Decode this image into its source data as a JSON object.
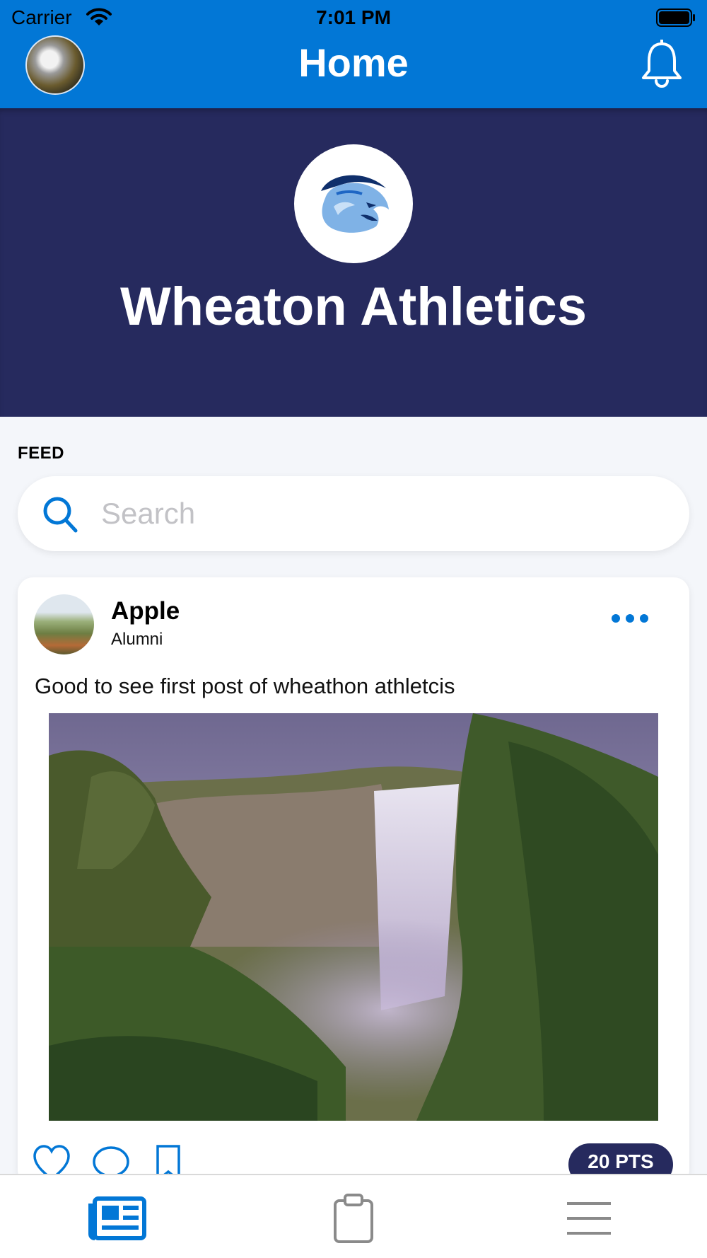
{
  "status_bar": {
    "carrier": "Carrier",
    "time": "7:01 PM",
    "wifi_icon": "wifi-icon",
    "battery_icon": "battery-icon"
  },
  "nav": {
    "title": "Home",
    "avatar_icon": "profile-avatar",
    "notification_icon": "bell-icon"
  },
  "hero": {
    "title": "Wheaton Athletics",
    "logo_icon": "wildcat-logo"
  },
  "feed": {
    "section_label": "FEED",
    "search": {
      "placeholder": "Search",
      "value": ""
    },
    "posts": [
      {
        "author": "Apple",
        "role": "Alumni",
        "text": "Good to see first post of wheathon athletcis",
        "points_label": "20 PTS",
        "image_icon": "waterfall-photo",
        "actions": [
          "heart-icon",
          "comment-icon",
          "bookmark-icon"
        ]
      }
    ]
  },
  "tabbar": {
    "items": [
      {
        "icon": "newspaper-icon",
        "active": true
      },
      {
        "icon": "clipboard-icon",
        "active": false
      },
      {
        "icon": "menu-icon",
        "active": false
      }
    ]
  },
  "colors": {
    "brand_blue": "#0277d6",
    "navy": "#262a5e",
    "background": "#f4f6fa",
    "inactive_icon": "#8a8a8a"
  }
}
